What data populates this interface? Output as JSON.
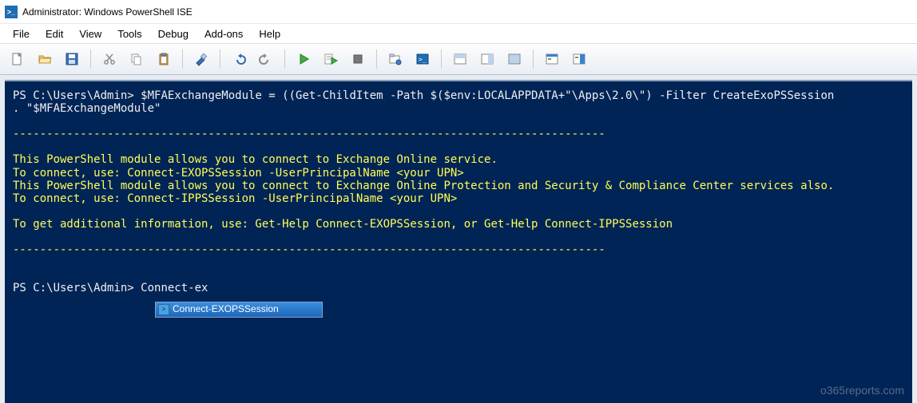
{
  "window": {
    "title": "Administrator: Windows PowerShell ISE"
  },
  "menu": {
    "items": [
      "File",
      "Edit",
      "View",
      "Tools",
      "Debug",
      "Add-ons",
      "Help"
    ]
  },
  "toolbar": {
    "new": "New",
    "open": "Open",
    "save": "Save",
    "cut": "Cut",
    "copy": "Copy",
    "paste": "Paste",
    "clear": "Clear",
    "undo": "Undo",
    "redo": "Redo",
    "run": "Run Script",
    "run_selection": "Run Selection",
    "stop": "Stop",
    "new_remote": "New Remote Tab",
    "start_powershell": "Start PowerShell",
    "pane_top": "Show Script Pane Top",
    "pane_right": "Show Script Pane Right",
    "pane_max": "Show Script Pane Maximized",
    "show_command": "Show Command",
    "show_command_addon": "Show Command Add-on"
  },
  "console": {
    "prompt1": "PS C:\\Users\\Admin> ",
    "cmd1": "$MFAExchangeModule = ((Get-ChildItem -Path $($env:LOCALAPPDATA+\"\\Apps\\2.0\\\") -Filter CreateExoPSSession",
    "line2": ". \"$MFAExchangeModule\"",
    "dashes": "----------------------------------------------------------------------------------------",
    "msg1": "This PowerShell module allows you to connect to Exchange Online service.",
    "msg2": "To connect, use: Connect-EXOPSSession -UserPrincipalName <your UPN>",
    "msg3": "This PowerShell module allows you to connect to Exchange Online Protection and Security & Compliance Center services also.",
    "msg4": "To connect, use: Connect-IPPSSession -UserPrincipalName <your UPN>",
    "msg5": "To get additional information, use: Get-Help Connect-EXOPSSession, or Get-Help Connect-IPPSSession",
    "prompt2": "PS C:\\Users\\Admin> ",
    "typed": "Connect-ex",
    "autocomplete": "Connect-EXOPSSession"
  },
  "watermark": "o365reports.com"
}
